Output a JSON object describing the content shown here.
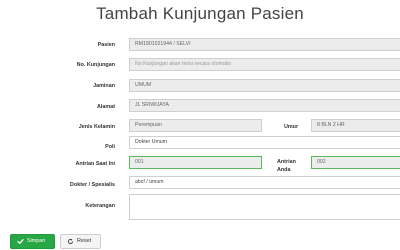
{
  "page_title": "Tambah Kunjungan Pasien",
  "form": {
    "pasien": {
      "label": "Pasien",
      "value": "RM1801021944 / SELVI"
    },
    "no_kunjungan": {
      "label": "No. Kunjungan",
      "placeholder": "No.Kunjungan akan terisi secara otomatis"
    },
    "jaminan": {
      "label": "Jaminan",
      "value": "UMUM"
    },
    "alamat": {
      "label": "Alamat",
      "value": "JL SRIWIJAYA"
    },
    "jenis_kelamin": {
      "label": "Jenis Kelamin",
      "value": "Perempuan"
    },
    "umur": {
      "label": "Umur",
      "value": "8 BLN  2 HR"
    },
    "poli": {
      "label": "Poli",
      "value": "Dokter Umum"
    },
    "antrian_saat_ini": {
      "label": "Antrian Saat Ini",
      "value": "001"
    },
    "antrian_anda": {
      "label": "Antrian Anda",
      "value": "002"
    },
    "dokter_spesialis": {
      "label": "Dokter / Spesialis",
      "value": "abcf / umum"
    },
    "keterangan": {
      "label": "Keterangan",
      "value": ""
    }
  },
  "buttons": {
    "save_label": "Simpan",
    "reset_label": "Reset"
  },
  "icons": {
    "save": "check-icon",
    "reset": "refresh-icon"
  },
  "colors": {
    "save_button": "#28a745",
    "focus_border": "#5cb85c",
    "readonly_field": "#ececec"
  }
}
